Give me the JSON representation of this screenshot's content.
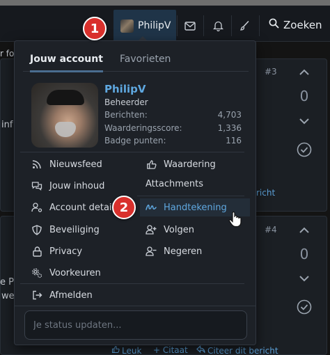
{
  "nav": {
    "username": "PhilipV",
    "search_label": "Zoeken",
    "icons": [
      "envelope-icon",
      "bell-icon",
      "brush-icon",
      "search-icon"
    ]
  },
  "annotations": {
    "badge1": "1",
    "badge2": "2"
  },
  "background": {
    "post1": {
      "number": "#3",
      "votes": "0",
      "fragment": "inf",
      "link": "richt",
      "top_fragment": "r fo"
    },
    "post2": {
      "number": "#4",
      "votes": "0",
      "fragment1": "e P",
      "fragment2": "we"
    },
    "actions": {
      "like": "Leuk",
      "quote": "+ Citaat",
      "reply_quote": "Citeer dit bericht"
    }
  },
  "menu": {
    "tabs": [
      "Jouw account",
      "Favorieten"
    ],
    "profile": {
      "name": "PhilipV",
      "role": "Beheerder",
      "stats": [
        {
          "label": "Berichten:",
          "value": "4,703"
        },
        {
          "label": "Waarderingsscore:",
          "value": "1,336"
        },
        {
          "label": "Badge punten:",
          "value": "116"
        }
      ]
    },
    "left_items": [
      {
        "label": "Nieuwsfeed",
        "icon": "rss-icon"
      },
      {
        "label": "Jouw inhoud",
        "icon": "comments-icon"
      },
      {
        "label": "Account details",
        "icon": "user-cog-icon"
      },
      {
        "label": "Beveiliging",
        "icon": "shield-icon"
      },
      {
        "label": "Privacy",
        "icon": "lock-icon"
      },
      {
        "label": "Voorkeuren",
        "icon": "cogs-icon"
      }
    ],
    "right_items": [
      {
        "label": "Waardering",
        "icon": "thumbs-up-icon"
      },
      {
        "label": "Handtekening",
        "icon": "signature-icon"
      },
      {
        "label": "Volgen",
        "icon": "user-plus-icon"
      },
      {
        "label": "Negeren",
        "icon": "user-minus-icon"
      }
    ],
    "attachments_heading": "Attachments",
    "logout": {
      "label": "Afmelden",
      "icon": "sign-out-icon"
    },
    "status_placeholder": "Je status updaten...",
    "highlight_color": "#5fa8e0"
  }
}
